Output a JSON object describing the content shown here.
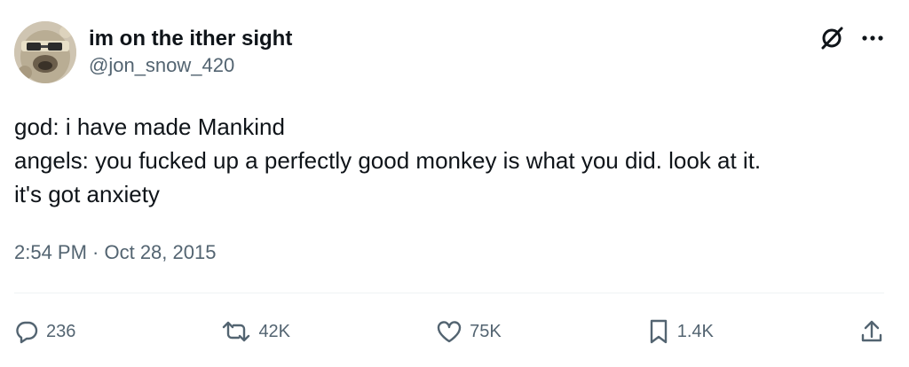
{
  "user": {
    "display_name": "im on the ither sight",
    "handle": "@jon_snow_420",
    "avatar_icon": "avatar-image"
  },
  "top_icons": {
    "grok_icon": "grok-icon",
    "more_icon": "more-icon"
  },
  "tweet": {
    "lines": [
      "god: i have made Mankind",
      "angels: you fucked up a perfectly good monkey is what you did. look at it.",
      "it's got anxiety"
    ],
    "timestamp": "2:54 PM · Oct 28, 2015"
  },
  "actions": {
    "replies": "236",
    "retweets": "42K",
    "likes": "75K",
    "bookmarks": "1.4K"
  },
  "colors": {
    "text": "#0f1419",
    "secondary": "#536471",
    "divider": "#eff3f4"
  }
}
